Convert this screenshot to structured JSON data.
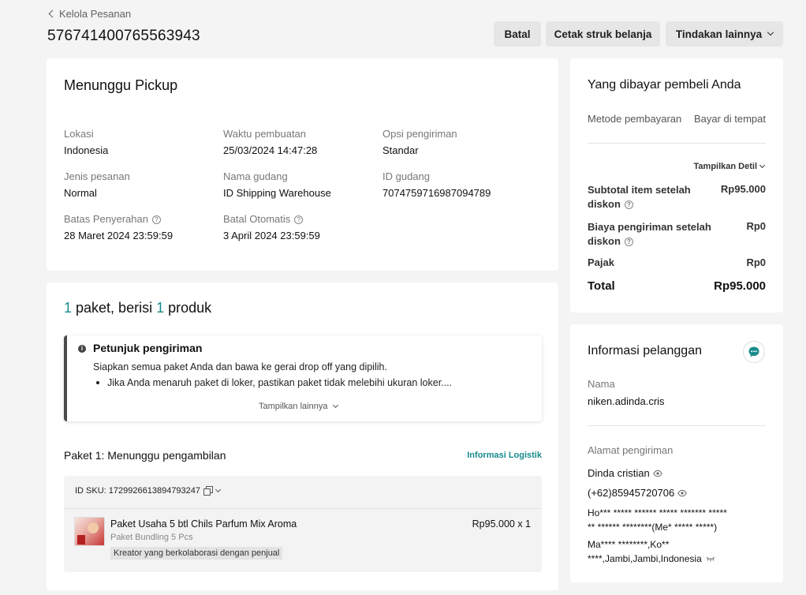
{
  "breadcrumb": {
    "back_label": "Kelola Pesanan"
  },
  "order": {
    "id": "576741400765563943"
  },
  "actions": {
    "cancel": "Batal",
    "print": "Cetak struk belanja",
    "more": "Tindakan lainnya"
  },
  "status": {
    "title": "Menunggu Pickup",
    "fields": [
      {
        "label": "Lokasi",
        "value": "Indonesia"
      },
      {
        "label": "Waktu pembuatan",
        "value": "25/03/2024 14:47:28"
      },
      {
        "label": "Opsi pengiriman",
        "value": "Standar"
      },
      {
        "label": "Jenis pesanan",
        "value": "Normal"
      },
      {
        "label": "Nama gudang",
        "value": "ID Shipping Warehouse"
      },
      {
        "label": "ID gudang",
        "value": "7074759716987094789"
      },
      {
        "label": "Batas Penyerahan",
        "value": "28 Maret 2024 23:59:59"
      },
      {
        "label": "Batal Otomatis",
        "value": "3 April 2024 23:59:59"
      }
    ]
  },
  "packages": {
    "count": "1",
    "word_paket": " paket, berisi ",
    "product_count": "1",
    "word_produk": " produk",
    "hint": {
      "title": "Petunjuk pengiriman",
      "text": "Siapkan semua paket Anda dan bawa ke gerai drop off yang dipilih.",
      "bullet": "Jika Anda menaruh paket di loker, pastikan paket tidak melebihi ukuran loker....",
      "show_more": "Tampilkan lainnya"
    },
    "package1": {
      "title": "Paket 1: Menunggu pengambilan",
      "logistics_link": "Informasi Logistik",
      "sku": "ID SKU: 1729926613894793247",
      "product_name": "Paket Usaha 5 btl Chils Parfum Mix Aroma",
      "variant": "Paket Bundling 5 Pcs",
      "tag": "Kreator yang berkolaborasi dengan penjual",
      "price": "Rp95.000 x 1"
    }
  },
  "payment": {
    "title": "Yang dibayar pembeli Anda",
    "method_label": "Metode pembayaran",
    "method_value": "Bayar di tempat",
    "show_detail": "Tampilkan Detil",
    "subtotal_label": "Subtotal item setelah diskon",
    "subtotal_value": "Rp95.000",
    "shipping_label": "Biaya pengiriman setelah diskon",
    "shipping_value": "Rp0",
    "tax_label": "Pajak",
    "tax_value": "Rp0",
    "total_label": "Total",
    "total_value": "Rp95.000"
  },
  "customer": {
    "title": "Informasi pelanggan",
    "name_label": "Nama",
    "name_value": "niken.adinda.cris",
    "address_label": "Alamat pengiriman",
    "recipient": "Dinda cristian",
    "phone": "(+62)85945720706",
    "address_line1": "Ho*** ***** ****** ***** ******* *****",
    "address_line2": "** ****** ********(Me* ***** *****)",
    "address_line3": "Ma**** ********,Ko**",
    "address_line4": "****,Jambi,Jambi,Indonesia"
  },
  "colors": {
    "accent": "#198a8a",
    "page_bg": "#f4f4f5",
    "card_bg": "#ffffff"
  },
  "icons": [
    "chevron-left-icon",
    "chevron-down-icon",
    "question-icon",
    "info-icon",
    "copy-icon",
    "eye-icon",
    "chat-icon"
  ]
}
